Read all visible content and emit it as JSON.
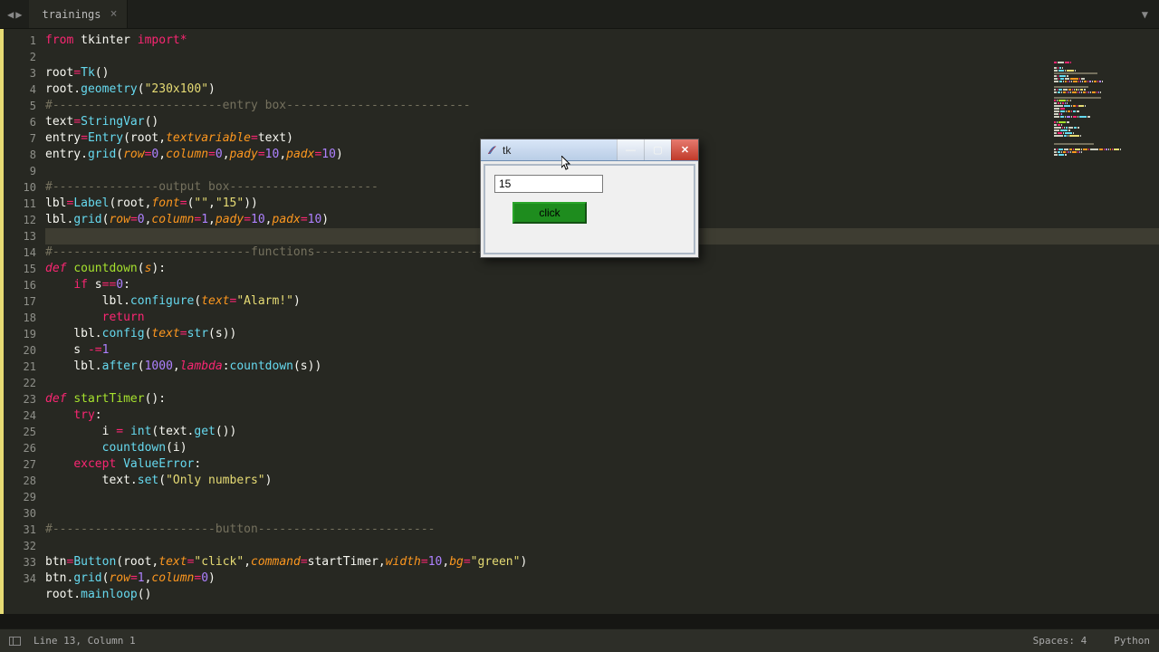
{
  "tab": {
    "name": "trainings"
  },
  "gutter": {
    "from": 1,
    "to": 34
  },
  "active_line_index": 12,
  "code_lines": [
    [
      {
        "c": "kw",
        "t": "from"
      },
      {
        "c": "",
        "t": " tkinter "
      },
      {
        "c": "kw",
        "t": "import"
      },
      {
        "c": "op",
        "t": "*"
      }
    ],
    [],
    [
      {
        "c": "",
        "t": "root"
      },
      {
        "c": "op",
        "t": "="
      },
      {
        "c": "fn",
        "t": "Tk"
      },
      {
        "c": "",
        "t": "()"
      }
    ],
    [
      {
        "c": "",
        "t": "root."
      },
      {
        "c": "fn",
        "t": "geometry"
      },
      {
        "c": "",
        "t": "("
      },
      {
        "c": "str",
        "t": "\"230x100\""
      },
      {
        "c": "",
        "t": ")"
      }
    ],
    [
      {
        "c": "cmnt",
        "t": "#------------------------entry box--------------------------"
      }
    ],
    [
      {
        "c": "",
        "t": "text"
      },
      {
        "c": "op",
        "t": "="
      },
      {
        "c": "fn",
        "t": "StringVar"
      },
      {
        "c": "",
        "t": "()"
      }
    ],
    [
      {
        "c": "",
        "t": "entry"
      },
      {
        "c": "op",
        "t": "="
      },
      {
        "c": "fn",
        "t": "Entry"
      },
      {
        "c": "",
        "t": "(root,"
      },
      {
        "c": "param",
        "t": "textvariable"
      },
      {
        "c": "op",
        "t": "="
      },
      {
        "c": "",
        "t": "text)"
      }
    ],
    [
      {
        "c": "",
        "t": "entry."
      },
      {
        "c": "fn",
        "t": "grid"
      },
      {
        "c": "",
        "t": "("
      },
      {
        "c": "param",
        "t": "row"
      },
      {
        "c": "op",
        "t": "="
      },
      {
        "c": "num",
        "t": "0"
      },
      {
        "c": "",
        "t": ","
      },
      {
        "c": "param",
        "t": "column"
      },
      {
        "c": "op",
        "t": "="
      },
      {
        "c": "num",
        "t": "0"
      },
      {
        "c": "",
        "t": ","
      },
      {
        "c": "param",
        "t": "pady"
      },
      {
        "c": "op",
        "t": "="
      },
      {
        "c": "num",
        "t": "10"
      },
      {
        "c": "",
        "t": ","
      },
      {
        "c": "param",
        "t": "padx"
      },
      {
        "c": "op",
        "t": "="
      },
      {
        "c": "num",
        "t": "10"
      },
      {
        "c": "",
        "t": ")"
      }
    ],
    [],
    [
      {
        "c": "cmnt",
        "t": "#---------------output box---------------------"
      }
    ],
    [
      {
        "c": "",
        "t": "lbl"
      },
      {
        "c": "op",
        "t": "="
      },
      {
        "c": "fn",
        "t": "Label"
      },
      {
        "c": "",
        "t": "(root,"
      },
      {
        "c": "param",
        "t": "font"
      },
      {
        "c": "op",
        "t": "="
      },
      {
        "c": "",
        "t": "("
      },
      {
        "c": "str",
        "t": "\"\""
      },
      {
        "c": "",
        "t": ","
      },
      {
        "c": "str",
        "t": "\"15\""
      },
      {
        "c": "",
        "t": "))"
      }
    ],
    [
      {
        "c": "",
        "t": "lbl."
      },
      {
        "c": "fn",
        "t": "grid"
      },
      {
        "c": "",
        "t": "("
      },
      {
        "c": "param",
        "t": "row"
      },
      {
        "c": "op",
        "t": "="
      },
      {
        "c": "num",
        "t": "0"
      },
      {
        "c": "",
        "t": ","
      },
      {
        "c": "param",
        "t": "column"
      },
      {
        "c": "op",
        "t": "="
      },
      {
        "c": "num",
        "t": "1"
      },
      {
        "c": "",
        "t": ","
      },
      {
        "c": "param",
        "t": "pady"
      },
      {
        "c": "op",
        "t": "="
      },
      {
        "c": "num",
        "t": "10"
      },
      {
        "c": "",
        "t": ","
      },
      {
        "c": "param",
        "t": "padx"
      },
      {
        "c": "op",
        "t": "="
      },
      {
        "c": "num",
        "t": "10"
      },
      {
        "c": "",
        "t": ")"
      }
    ],
    [],
    [
      {
        "c": "cmnt",
        "t": "#----------------------------functions---------------------------"
      }
    ],
    [
      {
        "c": "kw2",
        "t": "def"
      },
      {
        "c": "",
        "t": " "
      },
      {
        "c": "def",
        "t": "countdown"
      },
      {
        "c": "",
        "t": "("
      },
      {
        "c": "param",
        "t": "s"
      },
      {
        "c": "",
        "t": "):"
      }
    ],
    [
      {
        "c": "",
        "t": "    "
      },
      {
        "c": "kw",
        "t": "if"
      },
      {
        "c": "",
        "t": " s"
      },
      {
        "c": "op",
        "t": "=="
      },
      {
        "c": "num",
        "t": "0"
      },
      {
        "c": "",
        "t": ":"
      }
    ],
    [
      {
        "c": "",
        "t": "        lbl."
      },
      {
        "c": "fn",
        "t": "configure"
      },
      {
        "c": "",
        "t": "("
      },
      {
        "c": "param",
        "t": "text"
      },
      {
        "c": "op",
        "t": "="
      },
      {
        "c": "str",
        "t": "\"Alarm!\""
      },
      {
        "c": "",
        "t": ")"
      }
    ],
    [
      {
        "c": "",
        "t": "        "
      },
      {
        "c": "kw",
        "t": "return"
      }
    ],
    [
      {
        "c": "",
        "t": "    lbl."
      },
      {
        "c": "fn",
        "t": "config"
      },
      {
        "c": "",
        "t": "("
      },
      {
        "c": "param",
        "t": "text"
      },
      {
        "c": "op",
        "t": "="
      },
      {
        "c": "fn",
        "t": "str"
      },
      {
        "c": "",
        "t": "(s))"
      }
    ],
    [
      {
        "c": "",
        "t": "    s "
      },
      {
        "c": "op",
        "t": "-="
      },
      {
        "c": "num",
        "t": "1"
      }
    ],
    [
      {
        "c": "",
        "t": "    lbl."
      },
      {
        "c": "fn",
        "t": "after"
      },
      {
        "c": "",
        "t": "("
      },
      {
        "c": "num",
        "t": "1000"
      },
      {
        "c": "",
        "t": ","
      },
      {
        "c": "kw2",
        "t": "lambda"
      },
      {
        "c": "",
        "t": ":"
      },
      {
        "c": "fn",
        "t": "countdown"
      },
      {
        "c": "",
        "t": "(s))"
      }
    ],
    [],
    [
      {
        "c": "kw2",
        "t": "def"
      },
      {
        "c": "",
        "t": " "
      },
      {
        "c": "def",
        "t": "startTimer"
      },
      {
        "c": "",
        "t": "():"
      }
    ],
    [
      {
        "c": "",
        "t": "    "
      },
      {
        "c": "kw",
        "t": "try"
      },
      {
        "c": "",
        "t": ":"
      }
    ],
    [
      {
        "c": "",
        "t": "        i "
      },
      {
        "c": "op",
        "t": "="
      },
      {
        "c": "",
        "t": " "
      },
      {
        "c": "fn",
        "t": "int"
      },
      {
        "c": "",
        "t": "(text."
      },
      {
        "c": "fn",
        "t": "get"
      },
      {
        "c": "",
        "t": "())"
      }
    ],
    [
      {
        "c": "",
        "t": "        "
      },
      {
        "c": "fn",
        "t": "countdown"
      },
      {
        "c": "",
        "t": "(i)"
      }
    ],
    [
      {
        "c": "",
        "t": "    "
      },
      {
        "c": "kw",
        "t": "except"
      },
      {
        "c": "",
        "t": " "
      },
      {
        "c": "fn",
        "t": "ValueError"
      },
      {
        "c": "",
        "t": ":"
      }
    ],
    [
      {
        "c": "",
        "t": "        text."
      },
      {
        "c": "fn",
        "t": "set"
      },
      {
        "c": "",
        "t": "("
      },
      {
        "c": "str",
        "t": "\"Only numbers\""
      },
      {
        "c": "",
        "t": ")"
      }
    ],
    [],
    [],
    [
      {
        "c": "cmnt",
        "t": "#-----------------------button-------------------------"
      }
    ],
    [],
    [
      {
        "c": "",
        "t": "btn"
      },
      {
        "c": "op",
        "t": "="
      },
      {
        "c": "fn",
        "t": "Button"
      },
      {
        "c": "",
        "t": "(root,"
      },
      {
        "c": "param",
        "t": "text"
      },
      {
        "c": "op",
        "t": "="
      },
      {
        "c": "str",
        "t": "\"click\""
      },
      {
        "c": "",
        "t": ","
      },
      {
        "c": "param",
        "t": "command"
      },
      {
        "c": "op",
        "t": "="
      },
      {
        "c": "",
        "t": "startTimer,"
      },
      {
        "c": "param",
        "t": "width"
      },
      {
        "c": "op",
        "t": "="
      },
      {
        "c": "num",
        "t": "10"
      },
      {
        "c": "",
        "t": ","
      },
      {
        "c": "param",
        "t": "bg"
      },
      {
        "c": "op",
        "t": "="
      },
      {
        "c": "str",
        "t": "\"green\""
      },
      {
        "c": "",
        "t": ")"
      }
    ],
    [
      {
        "c": "",
        "t": "btn."
      },
      {
        "c": "fn",
        "t": "grid"
      },
      {
        "c": "",
        "t": "("
      },
      {
        "c": "param",
        "t": "row"
      },
      {
        "c": "op",
        "t": "="
      },
      {
        "c": "num",
        "t": "1"
      },
      {
        "c": "",
        "t": ","
      },
      {
        "c": "param",
        "t": "column"
      },
      {
        "c": "op",
        "t": "="
      },
      {
        "c": "num",
        "t": "0"
      },
      {
        "c": "",
        "t": ")"
      }
    ],
    [
      {
        "c": "",
        "t": "root."
      },
      {
        "c": "fn",
        "t": "mainloop"
      },
      {
        "c": "",
        "t": "()"
      }
    ]
  ],
  "status": {
    "pos": "Line 13, Column 1",
    "spaces": "Spaces: 4",
    "lang": "Python"
  },
  "tkinter": {
    "title": "tk",
    "entry_value": "15",
    "label_value": "",
    "button_label": "click"
  }
}
